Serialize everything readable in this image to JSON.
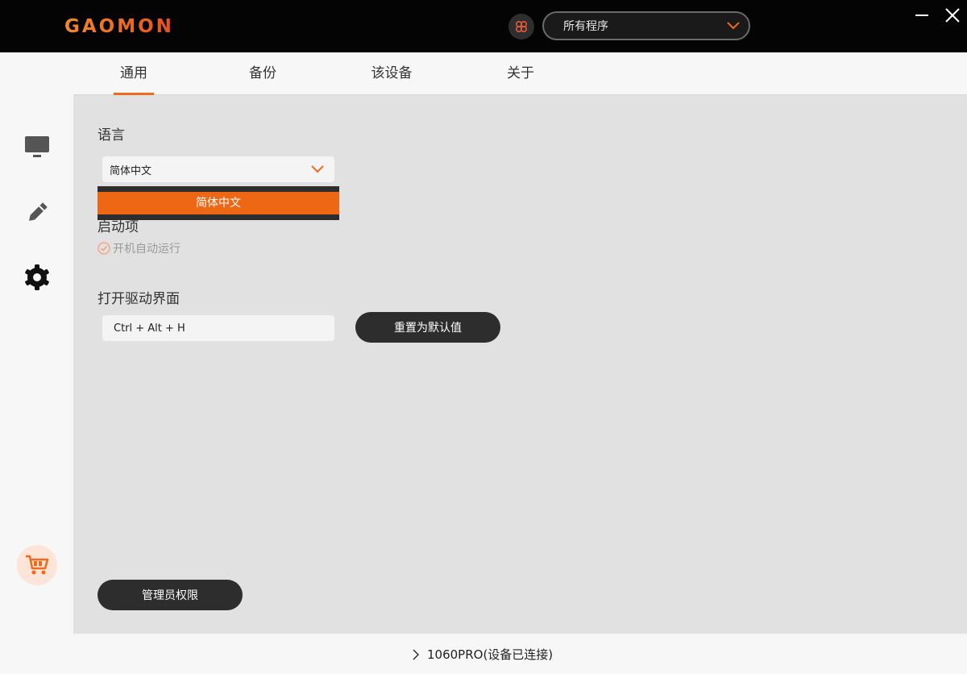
{
  "window": {
    "logo_text": "GAOMON",
    "app_select_value": "所有程序",
    "accent_color": "#ef6a1a"
  },
  "tabs": [
    {
      "label": "通用",
      "active": true
    },
    {
      "label": "备份",
      "active": false
    },
    {
      "label": "该设备",
      "active": false
    },
    {
      "label": "关于",
      "active": false
    }
  ],
  "sidebar": {
    "items": [
      {
        "icon": "monitor-icon"
      },
      {
        "icon": "pen-icon"
      },
      {
        "icon": "gear-icon",
        "active": true
      },
      {
        "icon": "cart-icon"
      }
    ]
  },
  "settings": {
    "language": {
      "label": "语言",
      "value": "简体中文",
      "options": [
        "简体中文"
      ]
    },
    "startup": {
      "label": "启动项",
      "checkbox_label": "开机自动运行",
      "checked": true
    },
    "open_driver": {
      "label": "打开驱动界面",
      "shortcut": "Ctrl + Alt + H",
      "reset_button": "重置为默认值"
    },
    "admin_button": "管理员权限"
  },
  "status": {
    "device_text": "1060PRO(设备已连接)"
  }
}
